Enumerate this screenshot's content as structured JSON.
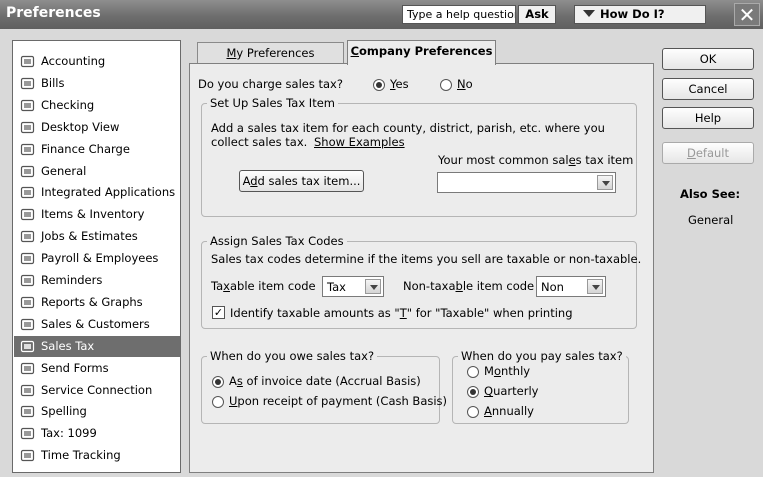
{
  "window": {
    "title": "Preferences",
    "help_placeholder": "Type a help question",
    "ask_label": "Ask",
    "howdoi_label": "How Do I?",
    "close_glyph": "✕"
  },
  "sidebar": {
    "selected": "Sales Tax",
    "items": [
      {
        "label": "Accounting",
        "icon": "accounting-icon"
      },
      {
        "label": "Bills",
        "icon": "bills-icon"
      },
      {
        "label": "Checking",
        "icon": "checking-icon"
      },
      {
        "label": "Desktop View",
        "icon": "desktop-view-icon"
      },
      {
        "label": "Finance Charge",
        "icon": "finance-charge-icon"
      },
      {
        "label": "General",
        "icon": "general-icon"
      },
      {
        "label": "Integrated Applications",
        "icon": "integrated-apps-icon"
      },
      {
        "label": "Items & Inventory",
        "icon": "items-inventory-icon"
      },
      {
        "label": "Jobs & Estimates",
        "icon": "jobs-estimates-icon"
      },
      {
        "label": "Payroll & Employees",
        "icon": "payroll-icon"
      },
      {
        "label": "Reminders",
        "icon": "reminders-icon"
      },
      {
        "label": "Reports & Graphs",
        "icon": "reports-graphs-icon"
      },
      {
        "label": "Sales & Customers",
        "icon": "sales-customers-icon"
      },
      {
        "label": "Sales Tax",
        "icon": "sales-tax-icon"
      },
      {
        "label": "Send Forms",
        "icon": "send-forms-icon"
      },
      {
        "label": "Service Connection",
        "icon": "service-connection-icon"
      },
      {
        "label": "Spelling",
        "icon": "spelling-icon"
      },
      {
        "label": "Tax: 1099",
        "icon": "tax-1099-icon"
      },
      {
        "label": "Time Tracking",
        "icon": "time-tracking-icon"
      }
    ]
  },
  "tabs": {
    "my_prefs": {
      "pre": "",
      "key": "M",
      "post": "y Preferences"
    },
    "company_prefs": {
      "pre": "",
      "key": "C",
      "post": "ompany Preferences"
    }
  },
  "sales_tax": {
    "question": "Do you charge sales tax?",
    "yes": {
      "key": "Y",
      "rest": "es"
    },
    "no": {
      "key": "N",
      "rest": "o"
    },
    "charge_selected": "yes",
    "setup_group": {
      "legend": "Set Up Sales Tax Item",
      "desc_line1": "Add a sales tax item for each county, district, parish, etc. where you",
      "desc_line2": "collect sales tax.",
      "show_examples": "Show Examples",
      "add_button": {
        "pre": "A",
        "key": "d",
        "post": "d sales tax item..."
      },
      "common_item_label": {
        "pre": "Your most common sal",
        "key": "e",
        "post": "s tax item"
      },
      "common_item_value": ""
    },
    "codes_group": {
      "legend": "Assign Sales Tax Codes",
      "desc": "Sales tax codes determine if the items you sell are taxable or non-taxable.",
      "taxable_label": {
        "pre": "Ta",
        "key": "x",
        "post": "able item code"
      },
      "taxable_value": "Tax",
      "nontaxable_label": {
        "pre": "Non-taxa",
        "key": "b",
        "post": "le item code"
      },
      "nontaxable_value": "Non",
      "identify": {
        "pre": "Identify taxable amounts as \"",
        "key": "T",
        "post": "\" for \"Taxable\" when printing"
      },
      "identify_checked": true
    },
    "owe_group": {
      "legend": "When do you owe sales tax?",
      "opt1": {
        "pre": "A",
        "key": "s",
        "post": " of invoice date (Accrual Basis)"
      },
      "opt2": {
        "pre": "",
        "key": "U",
        "post": "pon receipt of payment (Cash Basis)"
      },
      "selected": "accrual"
    },
    "pay_group": {
      "legend": "When do you pay sales tax?",
      "monthly": {
        "pre": "M",
        "key": "o",
        "post": "nthly"
      },
      "quarterly": {
        "pre": "",
        "key": "Q",
        "post": "uarterly"
      },
      "annually": {
        "pre": "",
        "key": "A",
        "post": "nnually"
      },
      "selected": "quarterly"
    }
  },
  "right_buttons": {
    "ok": "OK",
    "cancel": "Cancel",
    "help": "Help",
    "default": {
      "key": "D",
      "rest": "efault"
    },
    "also_see": "Also See:",
    "also_see_link": "General"
  }
}
